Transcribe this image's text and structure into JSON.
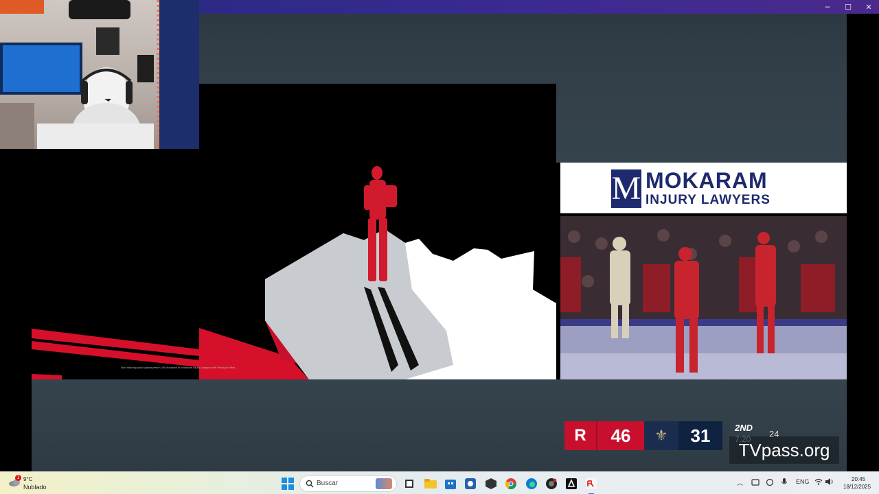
{
  "window": {
    "minimize_glyph": "─",
    "maximize_glyph": "☐",
    "close_glyph": "✕"
  },
  "ad": {
    "disclaimer": "Non attorney paid spokesperson. All Mokaram of Mokaram Injury Lawyers with Principal office ..."
  },
  "sponsor": {
    "logo_letter": "M",
    "name": "MOKARAM",
    "subtitle": "INJURY LAWYERS"
  },
  "scoreboard": {
    "home_logo": "R",
    "home_score": "46",
    "away_logo": "⚜",
    "away_score": "31",
    "period": "2ND",
    "clock": "7:20",
    "shot_clock": "24",
    "home_color": "#c8102e",
    "away_color": "#0f2240"
  },
  "watermark": "TVpass.org",
  "taskbar": {
    "weather_badge": "1",
    "weather_temp": "9°C",
    "weather_desc": "Nublado",
    "search_placeholder": "Buscar",
    "apps": [
      {
        "name": "file-explorer-icon"
      },
      {
        "name": "folder-icon"
      },
      {
        "name": "store-icon"
      },
      {
        "name": "settings-icon"
      },
      {
        "name": "app-icon"
      },
      {
        "name": "chrome-icon"
      },
      {
        "name": "edge-icon"
      },
      {
        "name": "obs-icon"
      },
      {
        "name": "adobe-icon"
      },
      {
        "name": "stream-app-icon"
      }
    ],
    "language": "ENG",
    "time": "20:45",
    "date": "18/12/2025",
    "accent": "#1a8fe0"
  }
}
